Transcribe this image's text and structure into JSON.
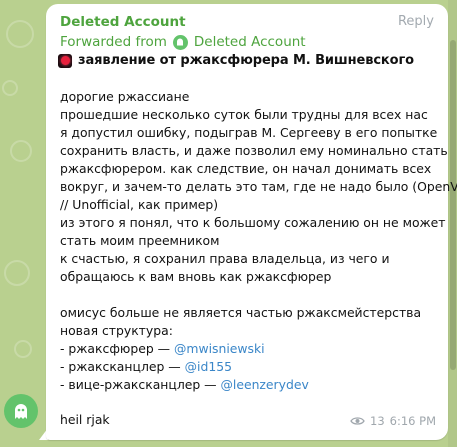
{
  "message": {
    "sender": "Deleted Account",
    "reply_label": "Reply",
    "forwarded_prefix": "Forwarded from",
    "forwarded_name": "Deleted Account",
    "title": "заявление от ржаксфюрера М. Вишневского",
    "lines": [
      "дорогие ржассиане",
      "прошедшие несколько суток были трудны для всех нас",
      "я допустил ошибку, подыграв М. Сергееву в его попытке",
      "сохранить власть, и даже позволил ему номинально стать",
      "ржаксфюрером. как следствие, он начал донимать всех",
      "вокруг, и зачем-то делать это там, где не надо было (OpenVK",
      "// Unofficial, как пример)",
      "из этого я понял, что к большому сожалению он не может",
      "стать моим преемником",
      "к счастью, я сохранил права владельца, из чего и",
      "обращаюсь к вам вновь как ржаксфюрер"
    ],
    "lines2": [
      "омисус больше не является частью ржаксмейстерства",
      "новая структура:"
    ],
    "roles": [
      {
        "label": "- ржаксфюрер — ",
        "handle": "@mwisniewski"
      },
      {
        "label": "- ржаксканцлер — ",
        "handle": "@id155"
      },
      {
        "label": "- вице-ржаксканцлер — ",
        "handle": "@leenzerydev"
      }
    ],
    "closing": "heil rjak",
    "views": "13",
    "time": "6:16 PM"
  },
  "colors": {
    "accent": "#4ea43e",
    "link": "#3a86c8",
    "background": "#b9d08f"
  }
}
